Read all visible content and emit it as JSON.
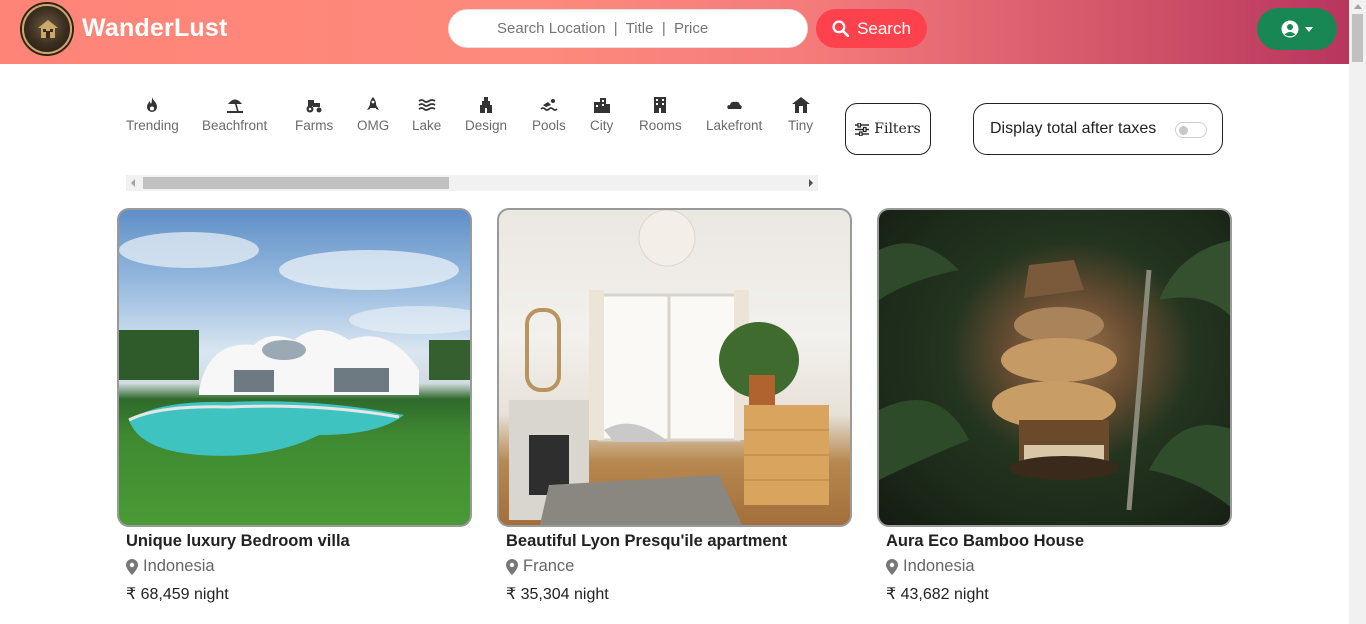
{
  "brand": {
    "name": "WanderLust"
  },
  "search": {
    "placeholder": "Search Location  |  Title  |  Price",
    "button_label": "Search"
  },
  "filters": [
    {
      "label": "Trending",
      "icon": "fire-icon"
    },
    {
      "label": "Beachfront",
      "icon": "umbrella-beach-icon"
    },
    {
      "label": "Farms",
      "icon": "tractor-icon"
    },
    {
      "label": "OMG",
      "icon": "rocket-icon"
    },
    {
      "label": "Lake",
      "icon": "water-icon"
    },
    {
      "label": "Design",
      "icon": "gopuram-icon"
    },
    {
      "label": "Pools",
      "icon": "person-swimming-icon"
    },
    {
      "label": "City",
      "icon": "city-icon"
    },
    {
      "label": "Rooms",
      "icon": "hotel-icon"
    },
    {
      "label": "Lakefront",
      "icon": "cloud-icon"
    },
    {
      "label": "Tiny",
      "icon": "house-icon"
    }
  ],
  "filters_button": {
    "label": "Filters"
  },
  "tax_toggle": {
    "label": "Display total after taxes",
    "checked": false
  },
  "listings": [
    {
      "title": "Unique luxury Bedroom villa",
      "location": "Indonesia",
      "price": "₹ 68,459 night"
    },
    {
      "title": "Beautiful Lyon Presqu'ile apartment",
      "location": "France",
      "price": "₹ 35,304 night"
    },
    {
      "title": "Aura Eco Bamboo House",
      "location": "Indonesia",
      "price": "₹ 43,682 night"
    }
  ],
  "colors": {
    "search_button": "#fe424d",
    "user_button": "#198754",
    "nav_start": "#fe8478",
    "nav_end": "#b8355f"
  }
}
